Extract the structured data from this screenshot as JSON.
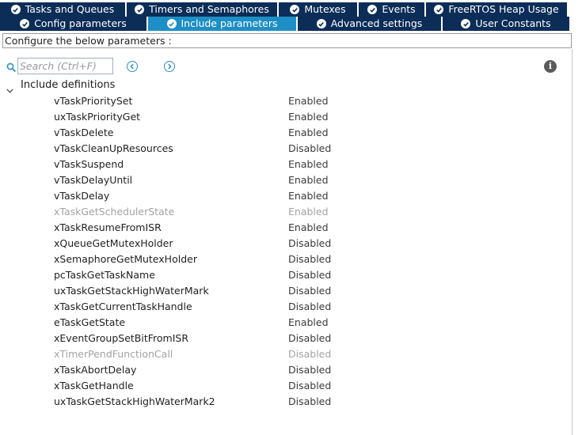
{
  "tabs": {
    "row1": [
      {
        "label": "Tasks and Queues",
        "active": false
      },
      {
        "label": "Timers and Semaphores",
        "active": false
      },
      {
        "label": "Mutexes",
        "active": false
      },
      {
        "label": "Events",
        "active": false
      },
      {
        "label": "FreeRTOS Heap Usage",
        "active": false
      }
    ],
    "row2": [
      {
        "label": "Config parameters",
        "active": false
      },
      {
        "label": "Include parameters",
        "active": true
      },
      {
        "label": "Advanced settings",
        "active": false
      },
      {
        "label": "User Constants",
        "active": false
      }
    ],
    "check_icon": "check-circle-icon",
    "colors": {
      "tab_bg": "#0b2d57",
      "tab_active_bg": "#1e8fc6"
    }
  },
  "description": "Configure the below parameters :",
  "search": {
    "placeholder": "Search (Ctrl+F)",
    "value": ""
  },
  "toolbar": {
    "prev_icon": "chevron-left-circle-icon",
    "next_icon": "chevron-right-circle-icon",
    "info_icon": "info-icon",
    "info_glyph": "i"
  },
  "group": {
    "label": "Include definitions",
    "expanded": true,
    "rows": [
      {
        "name": "vTaskPrioritySet",
        "value": "Enabled",
        "greyed": false
      },
      {
        "name": "uxTaskPriorityGet",
        "value": "Enabled",
        "greyed": false
      },
      {
        "name": "vTaskDelete",
        "value": "Enabled",
        "greyed": false
      },
      {
        "name": "vTaskCleanUpResources",
        "value": "Disabled",
        "greyed": false
      },
      {
        "name": "vTaskSuspend",
        "value": "Enabled",
        "greyed": false
      },
      {
        "name": "vTaskDelayUntil",
        "value": "Enabled",
        "greyed": false
      },
      {
        "name": "vTaskDelay",
        "value": "Enabled",
        "greyed": false
      },
      {
        "name": "xTaskGetSchedulerState",
        "value": "Enabled",
        "greyed": true
      },
      {
        "name": "xTaskResumeFromISR",
        "value": "Enabled",
        "greyed": false
      },
      {
        "name": "xQueueGetMutexHolder",
        "value": "Disabled",
        "greyed": false
      },
      {
        "name": "xSemaphoreGetMutexHolder",
        "value": "Disabled",
        "greyed": false
      },
      {
        "name": "pcTaskGetTaskName",
        "value": "Disabled",
        "greyed": false
      },
      {
        "name": "uxTaskGetStackHighWaterMark",
        "value": "Disabled",
        "greyed": false
      },
      {
        "name": "xTaskGetCurrentTaskHandle",
        "value": "Disabled",
        "greyed": false
      },
      {
        "name": "eTaskGetState",
        "value": "Enabled",
        "greyed": false
      },
      {
        "name": "xEventGroupSetBitFromISR",
        "value": "Disabled",
        "greyed": false
      },
      {
        "name": "xTimerPendFunctionCall",
        "value": "Disabled",
        "greyed": true
      },
      {
        "name": "xTaskAbortDelay",
        "value": "Disabled",
        "greyed": false
      },
      {
        "name": "xTaskGetHandle",
        "value": "Disabled",
        "greyed": false
      },
      {
        "name": "uxTaskGetStackHighWaterMark2",
        "value": "Disabled",
        "greyed": false
      }
    ]
  }
}
